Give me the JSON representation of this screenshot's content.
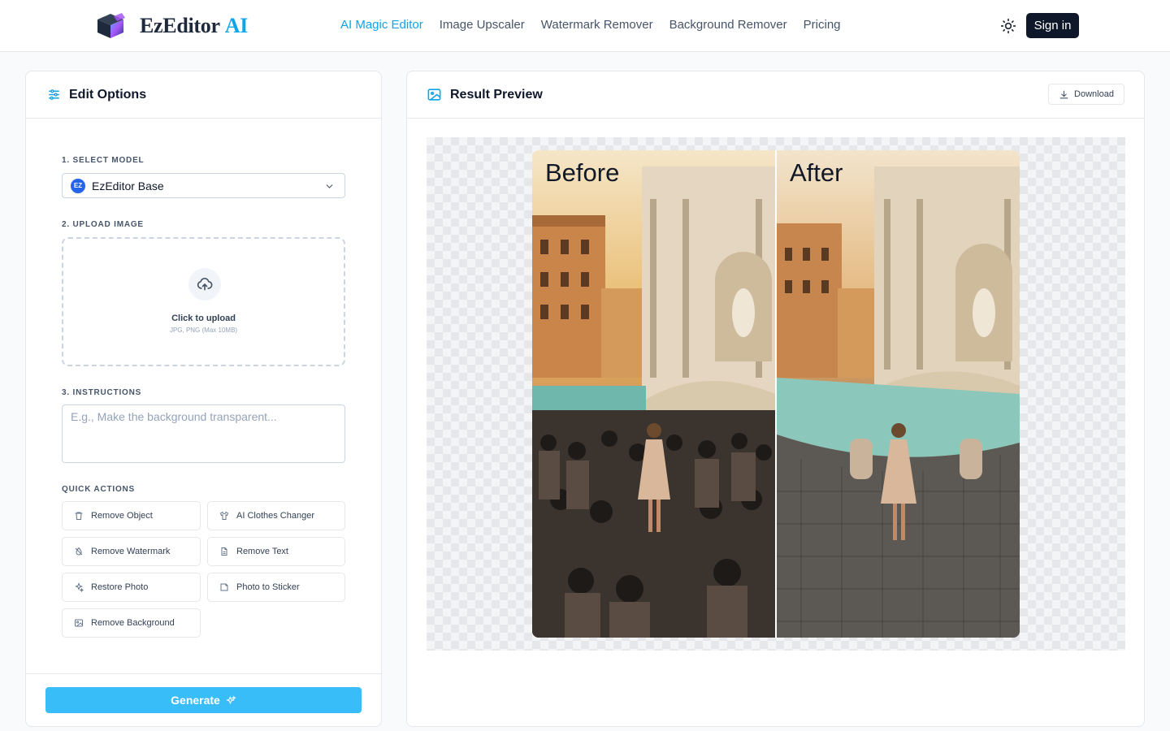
{
  "app": {
    "brand": "EzEditor",
    "brand_suffix": "AI",
    "accent": "#0ea5e9"
  },
  "nav": {
    "items": [
      {
        "label": "AI Magic Editor",
        "active": true
      },
      {
        "label": "Image Upscaler",
        "active": false
      },
      {
        "label": "Watermark Remover",
        "active": false
      },
      {
        "label": "Background Remover",
        "active": false
      },
      {
        "label": "Pricing",
        "active": false
      }
    ],
    "theme_icon": "sun-icon",
    "signin_label": "Sign in"
  },
  "edit": {
    "title": "Edit Options",
    "model_label": "1. SELECT MODEL",
    "model_badge": "EZ",
    "model_value": "EzEditor Base",
    "upload_label": "2. UPLOAD IMAGE",
    "upload_title": "Click to upload",
    "upload_sub": "JPG, PNG (Max 10MB)",
    "instructions_label": "3. INSTRUCTIONS",
    "instructions_placeholder": "E.g., Make the background transparent...",
    "quick_label": "QUICK ACTIONS",
    "quick_actions": [
      {
        "label": "Remove Object",
        "icon": "trash-icon"
      },
      {
        "label": "AI Clothes Changer",
        "icon": "shirt-icon"
      },
      {
        "label": "Remove Watermark",
        "icon": "drop-icon"
      },
      {
        "label": "Remove Text",
        "icon": "document-icon"
      },
      {
        "label": "Restore Photo",
        "icon": "sparkle-icon"
      },
      {
        "label": "Photo to Sticker",
        "icon": "sticker-icon"
      },
      {
        "label": "Remove Background",
        "icon": "image-icon"
      }
    ],
    "generate_label": "Generate"
  },
  "preview": {
    "title": "Result Preview",
    "download_label": "Download",
    "before_label": "Before",
    "after_label": "After"
  }
}
